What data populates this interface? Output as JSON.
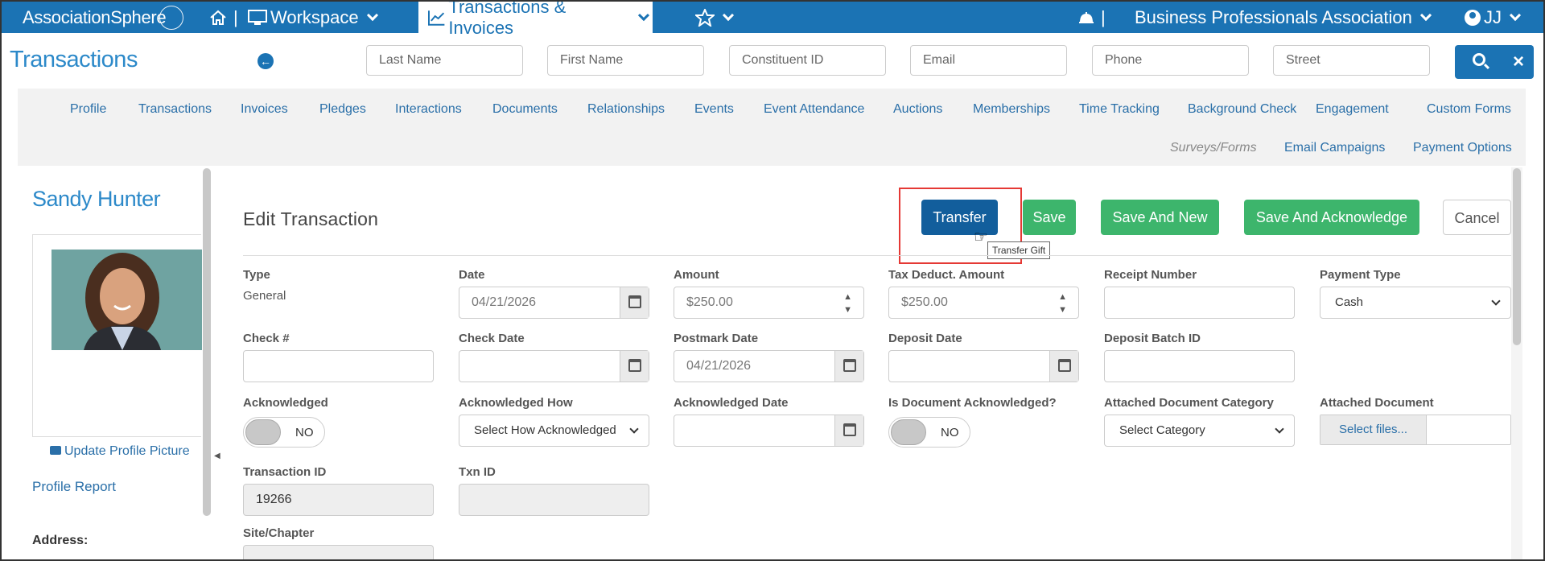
{
  "topbar": {
    "logo": "AssociationSphere",
    "workspace": "Workspace",
    "active_tab": "Transactions & Invoices",
    "org": "Business Professionals Association",
    "user": "JJ",
    "separator": "|"
  },
  "header": {
    "title": "Transactions",
    "search": {
      "last_name": "Last Name",
      "first_name": "First Name",
      "constituent_id": "Constituent ID",
      "email": "Email",
      "phone": "Phone",
      "street": "Street"
    }
  },
  "subnav": {
    "row1": [
      "Profile",
      "Transactions",
      "Invoices",
      "Pledges",
      "Interactions",
      "Documents",
      "Relationships",
      "Events",
      "Event Attendance",
      "Auctions",
      "Memberships",
      "Time Tracking",
      "Background Check",
      "Engagement",
      "Custom Forms"
    ],
    "row2": [
      "Surveys/Forms",
      "Email Campaigns",
      "Payment Options"
    ]
  },
  "sidebar": {
    "name": "Sandy Hunter",
    "update_photo": "Update Profile Picture",
    "profile_report": "Profile Report",
    "address_label": "Address:"
  },
  "main": {
    "title": "Edit Transaction",
    "buttons": {
      "transfer": "Transfer",
      "save": "Save",
      "save_new": "Save And New",
      "save_ack": "Save And Acknowledge",
      "cancel": "Cancel"
    },
    "tooltip": "Transfer Gift",
    "fields": {
      "type_label": "Type",
      "type_value": "General",
      "date_label": "Date",
      "date_value": "04/21/2026",
      "amount_label": "Amount",
      "amount_value": "$250.00",
      "tax_label": "Tax Deduct. Amount",
      "tax_value": "$250.00",
      "receipt_label": "Receipt Number",
      "paytype_label": "Payment Type",
      "paytype_value": "Cash",
      "check_label": "Check #",
      "checkdate_label": "Check Date",
      "postmark_label": "Postmark Date",
      "postmark_value": "04/21/2026",
      "deposit_label": "Deposit Date",
      "batch_label": "Deposit Batch ID",
      "ack_label": "Acknowledged",
      "ack_value": "NO",
      "ackhow_label": "Acknowledged How",
      "ackhow_value": "Select How Acknowledged",
      "ackdate_label": "Acknowledged Date",
      "docack_label": "Is Document Acknowledged?",
      "docack_value": "NO",
      "doccat_label": "Attached Document Category",
      "doccat_value": "Select Category",
      "attdoc_label": "Attached Document",
      "attdoc_button": "Select files...",
      "txnid_label": "Transaction ID",
      "txnid_value": "19266",
      "txn_label": "Txn ID",
      "site_label": "Site/Chapter"
    }
  },
  "colors": {
    "brand": "#1b73b4",
    "transfer": "#125e9c",
    "green": "#3db56c",
    "highlight": "#e53935"
  }
}
